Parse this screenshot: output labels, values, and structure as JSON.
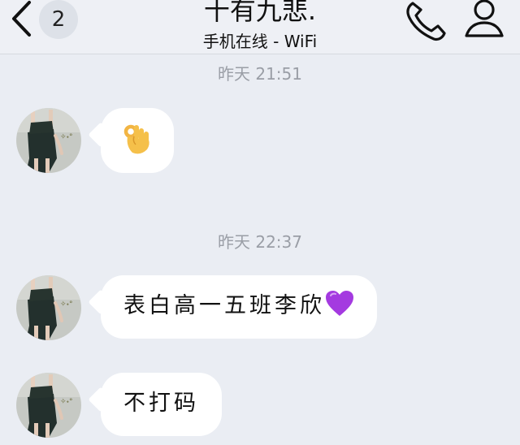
{
  "header": {
    "back_icon": "chevron-left-icon",
    "unread_count": "2",
    "contact_name": "十有九悲.",
    "status": "手机在线 - WiFi",
    "call_icon": "phone-icon",
    "profile_icon": "person-icon"
  },
  "chat": {
    "timestamps": [
      "昨天 21:51",
      "昨天 22:37"
    ],
    "messages": [
      {
        "type": "emoji",
        "content": "ok-hand-emoji"
      },
      {
        "type": "text",
        "text": "表白高一五班李欣",
        "emoji": "purple-heart-emoji"
      },
      {
        "type": "text",
        "text": "不打码"
      }
    ]
  },
  "colors": {
    "background": "#eaedf3",
    "bubble": "#ffffff",
    "timestamp": "#9a9ea6",
    "heart": "#a43ae0"
  }
}
